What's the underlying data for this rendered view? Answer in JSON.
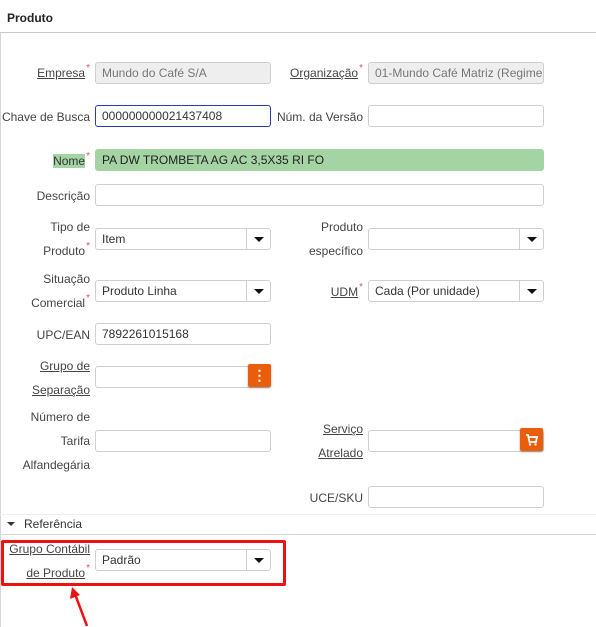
{
  "header": {
    "title": "Produto"
  },
  "fields": {
    "empresa": {
      "label": "Empresa",
      "value": "Mundo do Café S/A",
      "required": "*"
    },
    "organizacao": {
      "label": "Organização",
      "value": "01-Mundo Café Matriz (Regime",
      "required": "*"
    },
    "chave_busca": {
      "label": "Chave de Busca",
      "value": "000000000021437408"
    },
    "num_versao": {
      "label": "Núm. da Versão",
      "value": ""
    },
    "nome": {
      "label": "Nome",
      "value": "PA DW TROMBETA AG AC 3,5X35 RI FO",
      "required": "*"
    },
    "descricao": {
      "label": "Descrição",
      "value": ""
    },
    "tipo_produto": {
      "label_line1": "Tipo de",
      "label_line2": "Produto",
      "value": "Item",
      "required": "*"
    },
    "produto_especifico": {
      "label_line1": "Produto",
      "label_line2": "específico",
      "value": ""
    },
    "situacao_comercial": {
      "label_line1": "Situação",
      "label_line2": "Comercial",
      "value": "Produto Linha",
      "required": "*"
    },
    "udm": {
      "label": "UDM",
      "value": "Cada (Por unidade)",
      "required": "*"
    },
    "upc_ean": {
      "label": "UPC/EAN",
      "value": "7892261015168"
    },
    "grupo_separacao": {
      "label_line1": "Grupo de",
      "label_line2": "Separação",
      "value": ""
    },
    "numero_tarifa": {
      "label_line1": "Número de",
      "label_line2": "Tarifa",
      "label_line3": "Alfandegária",
      "value": ""
    },
    "servico_atrelado": {
      "label_line1": "Serviço",
      "label_line2": "Atrelado",
      "value": ""
    },
    "uce_sku": {
      "label": "UCE/SKU",
      "value": ""
    }
  },
  "section": {
    "label": "Referência"
  },
  "grupo_contabil": {
    "label_line1": "Grupo Contábil",
    "label_line2": "de Produto",
    "value": "Padrão",
    "required": "*"
  },
  "icons": {
    "menu": "⋮"
  },
  "colors": {
    "accent": "#ea5d0b",
    "highlight": "#a4d4a4",
    "annotation": "#ee1111"
  }
}
